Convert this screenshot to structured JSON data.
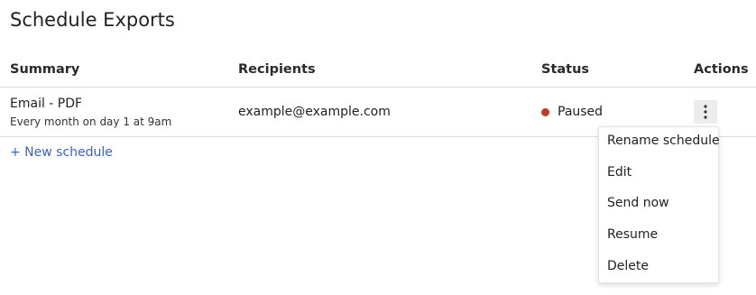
{
  "page": {
    "title": "Schedule Exports"
  },
  "table": {
    "headers": {
      "summary": "Summary",
      "recipients": "Recipients",
      "status": "Status",
      "actions": "Actions"
    },
    "rows": [
      {
        "summary_title": "Email - PDF",
        "summary_subtitle": "Every month on day 1 at 9am",
        "recipients": "example@example.com",
        "status": "Paused",
        "status_color": "#c0392b",
        "actions_icon": "kebab-icon"
      }
    ]
  },
  "new_schedule_label": "+ New schedule",
  "actions_menu": {
    "items": [
      "Rename schedule",
      "Edit",
      "Send now",
      "Resume",
      "Delete"
    ]
  },
  "colors": {
    "link": "#3a63c6",
    "paused": "#c0392b"
  }
}
